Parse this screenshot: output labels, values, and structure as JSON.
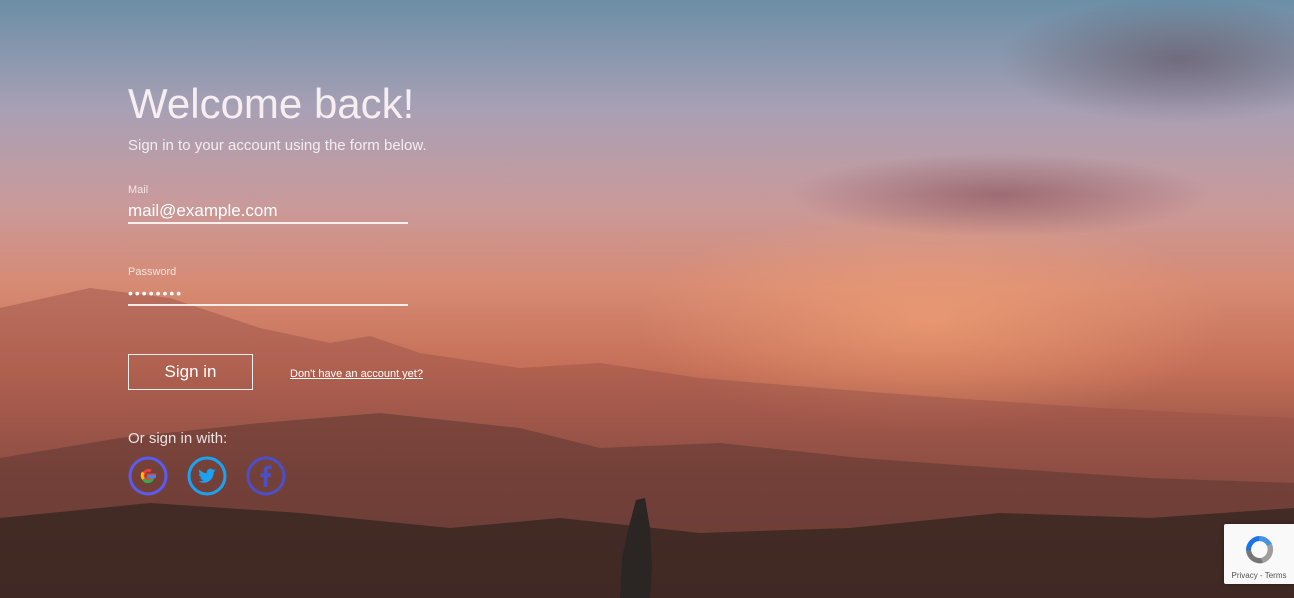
{
  "login": {
    "title": "Welcome back!",
    "subtitle": "Sign in to your account using the form below.",
    "mail_label": "Mail",
    "mail_value": "mail@example.com",
    "password_label": "Password",
    "password_value": "••••••••",
    "signin_label": "Sign in",
    "register_link": "Don't have an account yet?",
    "or_label": "Or sign in with:"
  },
  "social": [
    {
      "icon": "google-icon",
      "ring_color": "#5a5cf0"
    },
    {
      "icon": "twitter-icon",
      "ring_color": "#1da1f2"
    },
    {
      "icon": "facebook-icon",
      "ring_color": "#4b4fc8"
    }
  ],
  "recaptcha": {
    "links": "Privacy - Terms"
  }
}
